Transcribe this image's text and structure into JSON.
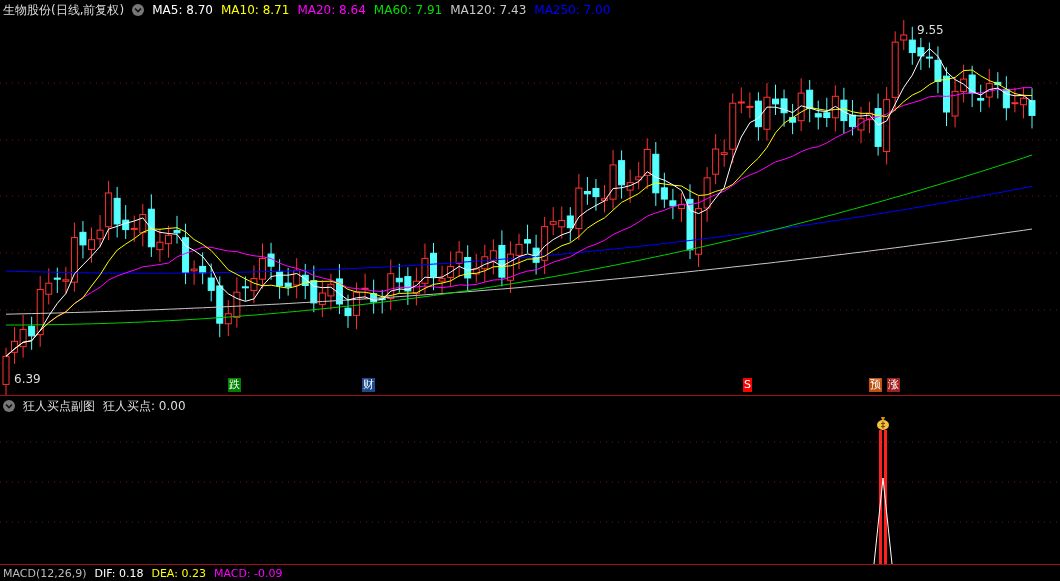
{
  "header": {
    "title": "生物股份(日线,前复权)",
    "indicators": [
      {
        "label": "MA5: 8.70",
        "color": "#ffffff"
      },
      {
        "label": "MA10: 8.71",
        "color": "#ffff00"
      },
      {
        "label": "MA20: 8.64",
        "color": "#ff00ff"
      },
      {
        "label": "MA60: 7.91",
        "color": "#00e000"
      },
      {
        "label": "MA120: 7.43",
        "color": "#c8c8c8"
      },
      {
        "label": "MA250: 7.00",
        "color": "#0000ff"
      }
    ]
  },
  "price_chart": {
    "high_label": "9.55",
    "low_label": "6.39",
    "signals": [
      {
        "text": "跌",
        "color": "#008000"
      },
      {
        "text": "财",
        "color": "#1c4a8c"
      },
      {
        "text": "S",
        "color": "#ff0000"
      },
      {
        "text": "预",
        "color": "#c05010"
      },
      {
        "text": "涨",
        "color": "#a02020"
      }
    ]
  },
  "sub_panel": {
    "title": "狂人买点副图",
    "reading": "狂人买点: 0.00"
  },
  "macd": {
    "title": "MACD(12,26,9)",
    "readings": [
      {
        "label": "DIF: 0.18",
        "color": "#ffffff"
      },
      {
        "label": "DEA: 0.23",
        "color": "#ffff00"
      },
      {
        "label": "MACD: -0.09",
        "color": "#ff00ff"
      }
    ]
  }
}
